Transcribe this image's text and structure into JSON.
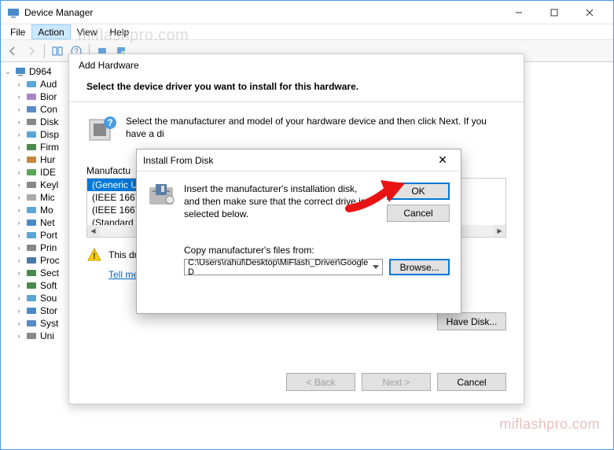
{
  "window": {
    "title": "Device Manager",
    "menu": [
      "File",
      "Action",
      "View",
      "Help"
    ],
    "active_menu": "Action"
  },
  "tree": {
    "root": "D964",
    "items": [
      {
        "label": "Aud",
        "icon": "audio"
      },
      {
        "label": "Bior",
        "icon": "biometric"
      },
      {
        "label": "Con",
        "icon": "computer"
      },
      {
        "label": "Disk",
        "icon": "disk"
      },
      {
        "label": "Disp",
        "icon": "display"
      },
      {
        "label": "Firm",
        "icon": "firmware"
      },
      {
        "label": "Hur",
        "icon": "hid"
      },
      {
        "label": "IDE",
        "icon": "ide"
      },
      {
        "label": "Keyl",
        "icon": "keyboard"
      },
      {
        "label": "Mic",
        "icon": "mouse"
      },
      {
        "label": "Mo",
        "icon": "monitor"
      },
      {
        "label": "Net",
        "icon": "network"
      },
      {
        "label": "Port",
        "icon": "port"
      },
      {
        "label": "Prin",
        "icon": "printer"
      },
      {
        "label": "Proc",
        "icon": "processor"
      },
      {
        "label": "Sect",
        "icon": "security"
      },
      {
        "label": "Soft",
        "icon": "software"
      },
      {
        "label": "Sou",
        "icon": "sound"
      },
      {
        "label": "Stor",
        "icon": "storage"
      },
      {
        "label": "Syst",
        "icon": "system"
      },
      {
        "label": "Uni",
        "icon": "usb"
      }
    ]
  },
  "wizard": {
    "title": "Add Hardware",
    "heading": "Select the device driver you want to install for this hardware.",
    "info": "Select the manufacturer and model of your hardware device and then click Next. If you have a di",
    "manufacturer_label": "Manufactu",
    "list": [
      "(Generic U!",
      "(IEEE 1667 (",
      "(IEEE 1667 (",
      "(Standard c"
    ],
    "selected_index": 0,
    "warn_text": "This dri",
    "link": "Tell me why driver signing is important",
    "have_disk": "Have Disk...",
    "buttons": {
      "back": "< Back",
      "next": "Next >",
      "cancel": "Cancel"
    }
  },
  "disk_dialog": {
    "title": "Install From Disk",
    "instruction": "Insert the manufacturer's installation disk, and then make sure that the correct drive is selected below.",
    "copy_label": "Copy manufacturer's files from:",
    "path": "C:\\Users\\rahul\\Desktop\\MiFlash_Driver\\Google D",
    "ok": "OK",
    "cancel": "Cancel",
    "browse": "Browse..."
  },
  "watermark": "miflashpro.com"
}
